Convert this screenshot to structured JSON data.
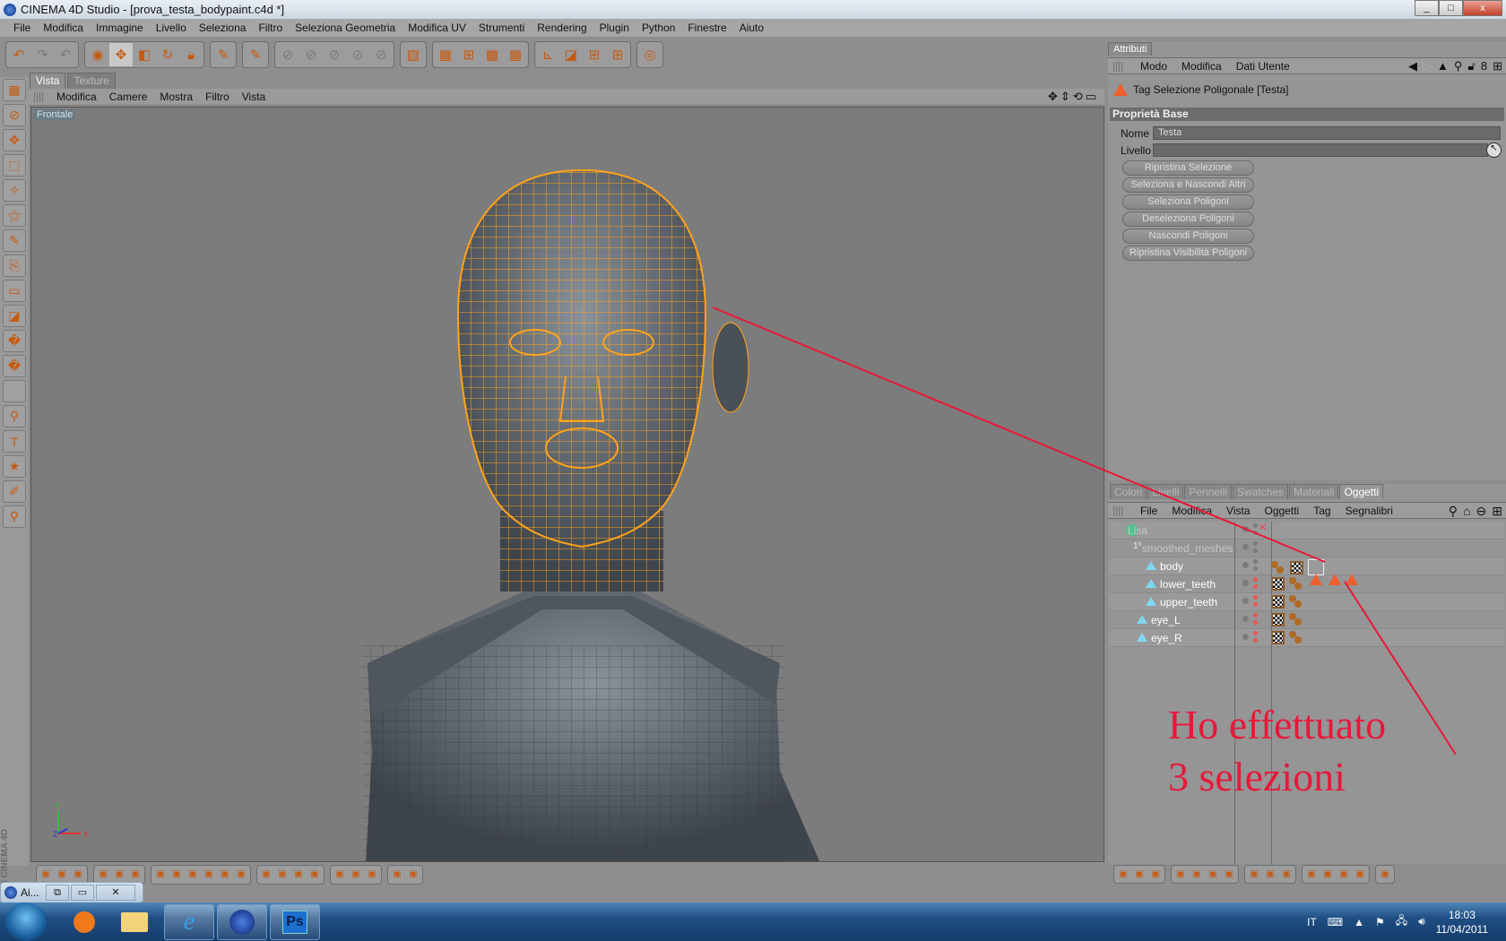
{
  "window": {
    "title": "CINEMA 4D Studio - [prova_testa_bodypaint.c4d *]",
    "controls": [
      "_",
      "□",
      "x"
    ]
  },
  "menubar": [
    "File",
    "Modifica",
    "Immagine",
    "Livello",
    "Seleziona",
    "Filtro",
    "Seleziona Geometria",
    "Modifica UV",
    "Strumenti",
    "Rendering",
    "Plugin",
    "Python",
    "Finestre",
    "Aiuto"
  ],
  "toolbar": {
    "groups": [
      [
        "undo-icon",
        "redo-icon",
        "paint-undo-icon"
      ],
      [
        "live-select-icon",
        "move-icon",
        "scale-icon",
        "rotate-icon",
        "lock-texture-icon"
      ],
      [
        "magic-brush-icon"
      ],
      [
        "paint-3d-icon"
      ],
      [
        "projection-a-icon",
        "projection-b-icon",
        "projection-c-icon",
        "projection-d-icon",
        "projection-e-icon"
      ],
      [
        "uv-edit-icon"
      ],
      [
        "texture-mode-icon",
        "uv-points-icon",
        "uv-grid-icon",
        "checker-icon"
      ],
      [
        "axis-icon",
        "layout-a-icon",
        "layout-b-icon",
        "layout-c-icon"
      ],
      [
        "render-icon"
      ]
    ],
    "icon_label_3d": "3D"
  },
  "viewport": {
    "tabs": [
      {
        "label": "Vista",
        "active": true
      },
      {
        "label": "Texture",
        "active": false
      }
    ],
    "menu": [
      "Modifica",
      "Camere",
      "Mostra",
      "Filtro",
      "Vista"
    ],
    "camera_name": "Frontale",
    "axis_labels": {
      "x": "X",
      "y": "Y",
      "z": "Z"
    }
  },
  "brand_watermark": "MAXON CINEMA 4D",
  "attributes": {
    "tab": "Attributi",
    "menu": [
      "Modo",
      "Modifica",
      "Dati Utente"
    ],
    "tag_title": "Tag Selezione Poligonale [Testa]",
    "section": "Proprietà Base",
    "fields": {
      "name_label": "Nome",
      "name_value": "Testa",
      "layer_label": "Livello",
      "layer_value": ""
    },
    "buttons": [
      "Ripristina Selezione",
      "Seleziona e Nascondi Altri",
      "Seleziona Poligoni",
      "Deseleziona Poligoni",
      "Nascondi Poligoni",
      "Ripristina Visibilità Poligoni"
    ]
  },
  "objects": {
    "tabs": [
      {
        "label": "Colori"
      },
      {
        "label": "Livelli"
      },
      {
        "label": "Pennelli"
      },
      {
        "label": "Swatches"
      },
      {
        "label": "Materiali"
      },
      {
        "label": "Oggetti",
        "active": true
      }
    ],
    "menu": [
      "File",
      "Modifica",
      "Vista",
      "Oggetti",
      "Tag",
      "Segnalibri"
    ],
    "tree": [
      {
        "name": "Lisa",
        "dim": true,
        "tags": []
      },
      {
        "name": "smoothed_meshes",
        "dim": true,
        "tags": []
      },
      {
        "name": "body",
        "tags": [
          "material-balls",
          "texture-tag",
          "selection-tag",
          "selection-tag",
          "selection-tag"
        ]
      },
      {
        "name": "lower_teeth",
        "tags": [
          "texture-tag",
          "material-balls"
        ]
      },
      {
        "name": "upper_teeth",
        "tags": [
          "texture-tag",
          "material-balls"
        ]
      },
      {
        "name": "eye_L",
        "tags": [
          "texture-tag",
          "material-balls"
        ]
      },
      {
        "name": "eye_R",
        "tags": [
          "texture-tag",
          "material-balls"
        ]
      }
    ]
  },
  "annotation": {
    "line1": "Ho effettuato",
    "line2": "3 selezioni",
    "color": "#e8183a"
  },
  "floating_window": {
    "label": "Ai..."
  },
  "taskbar": {
    "apps": [
      "windows-media-player",
      "explorer",
      "internet-explorer",
      "cinema-4d",
      "photoshop"
    ],
    "ps_label": "Ps",
    "language": "IT",
    "time": "18:03",
    "date": "11/04/2011"
  },
  "colors": {
    "accent_orange": "#f5a623",
    "wire": "#ffa31a",
    "selection_tag": "#ee5e2e",
    "panel": "#959595"
  }
}
